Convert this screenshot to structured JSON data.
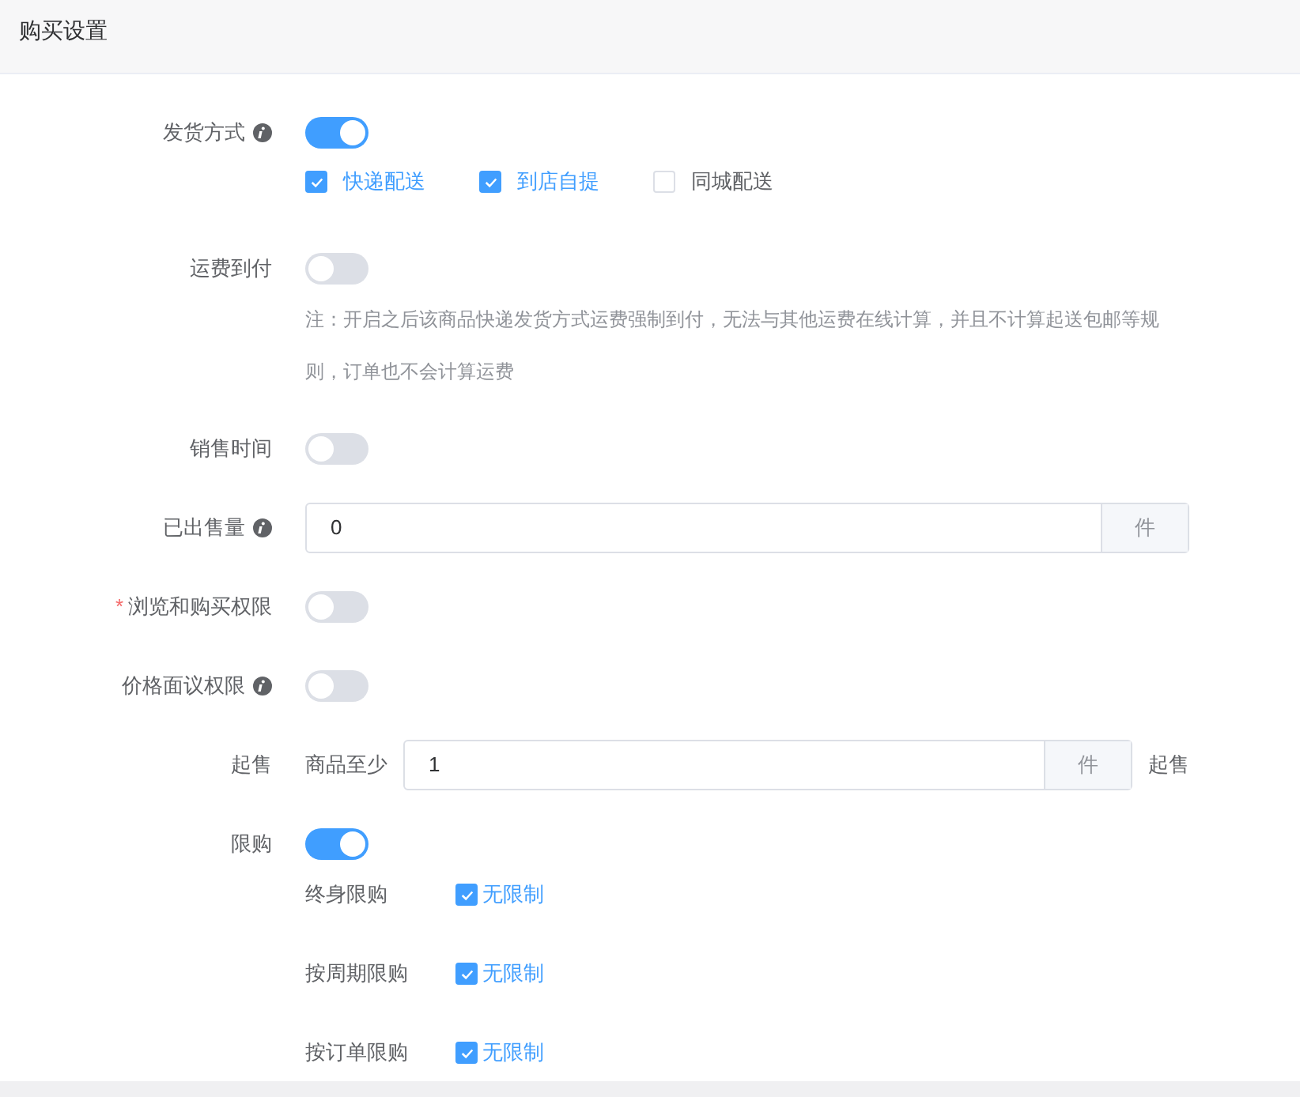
{
  "header": {
    "title": "购买设置"
  },
  "rows": [
    {
      "kind": "toggle",
      "label": "发货方式",
      "info": true,
      "on": true,
      "options": [
        {
          "label": "快递配送",
          "checked": true
        },
        {
          "label": "到店自提",
          "checked": true
        },
        {
          "label": "同城配送",
          "checked": false
        }
      ]
    },
    {
      "kind": "toggle",
      "label": "运费到付",
      "info": false,
      "on": false,
      "note": "注：开启之后该商品快递发货方式运费强制到付，无法与其他运费在线计算，并且不计算起送包邮等规则，订单也不会计算运费"
    },
    {
      "kind": "toggle",
      "label": "销售时间",
      "info": false,
      "on": false
    },
    {
      "kind": "input",
      "label": "已出售量",
      "info": true,
      "value": "0",
      "suffix": "件"
    },
    {
      "kind": "toggle",
      "label": "浏览和购买权限",
      "required_mark": "*",
      "info": false,
      "on": false
    },
    {
      "kind": "toggle",
      "label": "价格面议权限",
      "info": true,
      "on": false
    },
    {
      "kind": "input",
      "label": "起售",
      "info": false,
      "prefix": "商品至少",
      "value": "1",
      "suffix": "件",
      "after": "起售"
    },
    {
      "kind": "toggle",
      "label": "限购",
      "info": false,
      "on": true,
      "limits": [
        {
          "label": "终身限购",
          "option": "无限制",
          "checked": true
        },
        {
          "label": "按周期限购",
          "option": "无限制",
          "checked": true
        },
        {
          "label": "按订单限购",
          "option": "无限制",
          "checked": true
        }
      ]
    }
  ]
}
